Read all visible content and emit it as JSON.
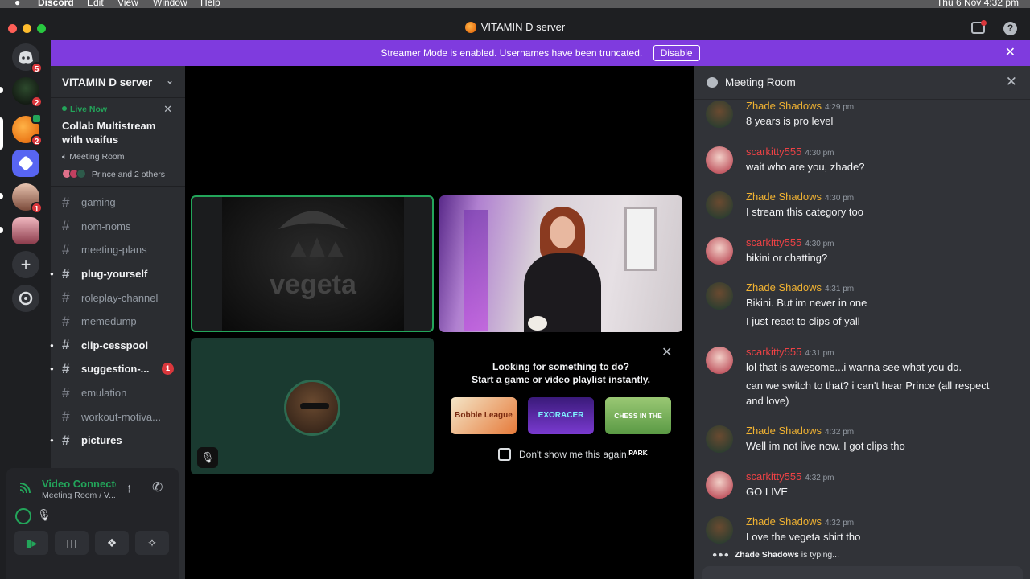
{
  "menubar": {
    "app": "Discord",
    "items": [
      "Edit",
      "View",
      "Window",
      "Help"
    ],
    "clock": "Thu 6 Nov  4:32 pm"
  },
  "window": {
    "title": "VITAMIN D server"
  },
  "banner": {
    "text": "Streamer Mode is enabled. Usernames have been truncated.",
    "button": "Disable"
  },
  "rail": {
    "badges": [
      "5",
      "2",
      "2",
      "1"
    ]
  },
  "sidebar": {
    "server_name": "VITAMIN D server",
    "live": {
      "label": "Live Now",
      "title": "Collab Multistream with waifus",
      "room": "Meeting Room",
      "people": "Prince and 2 others"
    },
    "channels": [
      {
        "name": "gaming",
        "bold": false
      },
      {
        "name": "nom-noms",
        "bold": false
      },
      {
        "name": "meeting-plans",
        "bold": false
      },
      {
        "name": "plug-yourself",
        "bold": true
      },
      {
        "name": "roleplay-channel",
        "bold": false
      },
      {
        "name": "memedump",
        "bold": false
      },
      {
        "name": "clip-cesspool",
        "bold": true
      },
      {
        "name": "suggestion-...",
        "bold": true,
        "badge": "1"
      },
      {
        "name": "emulation",
        "bold": false
      },
      {
        "name": "workout-motiva...",
        "bold": false
      },
      {
        "name": "pictures",
        "bold": true
      }
    ]
  },
  "voice": {
    "status": "Video Connected",
    "location": "Meeting Room / V..."
  },
  "stage": {
    "vegeta_text": "vegeta",
    "activity": {
      "line1": "Looking for something to do?",
      "line2": "Start a game or video playlist instantly.",
      "cards": [
        "Bobble League",
        "EXORACER",
        "CHESS IN THE PARK"
      ],
      "checkbox_label": "Don't show me this again."
    }
  },
  "chat": {
    "title": "Meeting Room",
    "messages": [
      {
        "user": "Zhade Shadows",
        "time": "4:29 pm",
        "lines": [
          "8 years is pro level"
        ]
      },
      {
        "user": "scarkitty555",
        "time": "4:30 pm",
        "lines": [
          "wait who are you, zhade?"
        ]
      },
      {
        "user": "Zhade Shadows",
        "time": "4:30 pm",
        "lines": [
          "I stream this category too"
        ]
      },
      {
        "user": "scarkitty555",
        "time": "4:30 pm",
        "lines": [
          "bikini or chatting?"
        ]
      },
      {
        "user": "Zhade Shadows",
        "time": "4:31 pm",
        "lines": [
          "Bikini. But im never in one",
          "I just react to clips of yall"
        ]
      },
      {
        "user": "scarkitty555",
        "time": "4:31 pm",
        "lines": [
          "lol that is awesome...i wanna see what you do.",
          "can we switch to that? i can't hear Prince (all respect and love)"
        ]
      },
      {
        "user": "Zhade Shadows",
        "time": "4:32 pm",
        "lines": [
          "Well im not live now. I got clips tho"
        ]
      },
      {
        "user": "scarkitty555",
        "time": "4:32 pm",
        "lines": [
          "GO LIVE"
        ]
      },
      {
        "user": "Zhade Shadows",
        "time": "4:32 pm",
        "lines": [
          "Love the vegeta shirt tho"
        ]
      }
    ],
    "typing_user": "Zhade Shadows",
    "typing_suffix": " is typing..."
  },
  "colors": {
    "accent": "#7f3bde",
    "online": "#23a55a",
    "zhade": "#f0b232",
    "scarkitty": "#ed4245"
  }
}
